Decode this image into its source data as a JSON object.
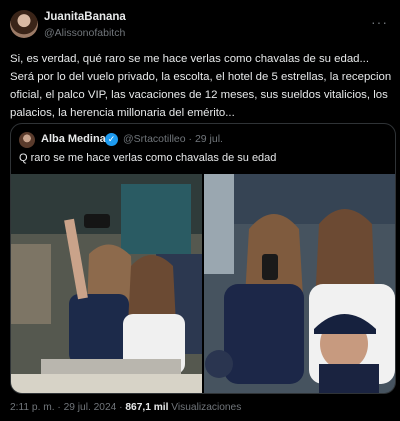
{
  "author": {
    "name": "JuanitaBanana",
    "handle": "@Alissonofabitch"
  },
  "tweet": {
    "text": "Si, es verdad, qué raro se me hace verlas como chavalas de su edad... Será por lo del vuelo privado, la escolta, el hotel de 5 estrellas, la recepcion oficial, el palco VIP, las vacaciones de 12 meses, sus sueldos vitalicios, los palacios, la herencia millonaria del emérito..."
  },
  "quoted": {
    "name": "Alba Medina",
    "handle": "@Srtacotilleo",
    "date": "29 jul.",
    "text": "Q raro se me hace verlas como chavalas de su edad"
  },
  "footer": {
    "time": "2:11 p. m.",
    "date": "29 jul. 2024",
    "views": "867,1 mil",
    "views_label": "Visualizaciones"
  },
  "icons": {
    "more": "more-icon",
    "verified": "verified-badge-icon"
  },
  "colors": {
    "background": "#000000",
    "text": "#e7e9ea",
    "muted": "#71767b",
    "verified": "#1d9bf0",
    "border": "#2f3336"
  }
}
